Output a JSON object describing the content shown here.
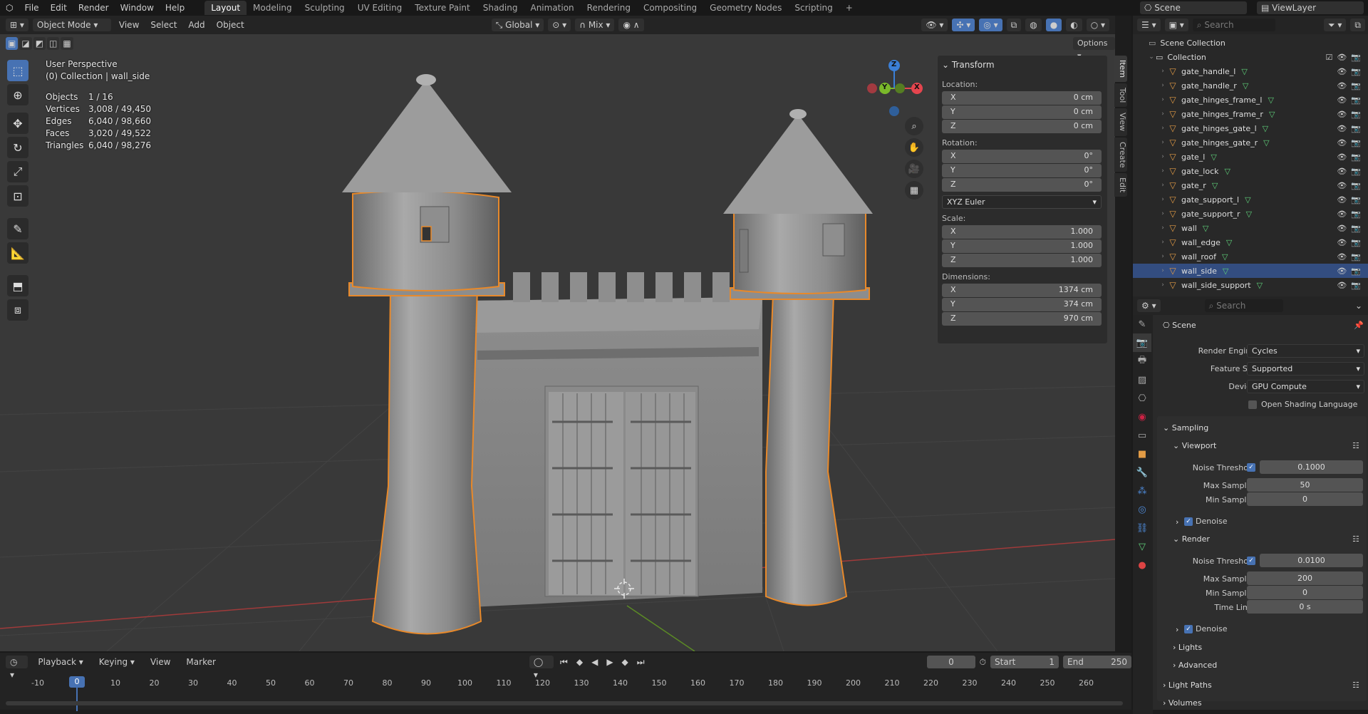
{
  "menu": {
    "items": [
      "File",
      "Edit",
      "Render",
      "Window",
      "Help"
    ]
  },
  "workspaces": [
    "Layout",
    "Modeling",
    "Sculpting",
    "UV Editing",
    "Texture Paint",
    "Shading",
    "Animation",
    "Rendering",
    "Compositing",
    "Geometry Nodes",
    "Scripting"
  ],
  "top_right": {
    "scene": "Scene",
    "view_layer": "ViewLayer"
  },
  "vp_header": {
    "mode": "Object Mode",
    "menus": [
      "View",
      "Select",
      "Add",
      "Object"
    ],
    "orientation": "Global",
    "snap": "Mix",
    "options": "Options"
  },
  "overlay": {
    "perspective": "User Perspective",
    "collection": "(0) Collection | wall_side",
    "stats": [
      {
        "k": "Objects",
        "v": "1 / 16"
      },
      {
        "k": "Vertices",
        "v": "3,008 / 49,450"
      },
      {
        "k": "Edges",
        "v": "6,040 / 98,660"
      },
      {
        "k": "Faces",
        "v": "3,020 / 49,522"
      },
      {
        "k": "Triangles",
        "v": "6,040 / 98,276"
      }
    ]
  },
  "transform": {
    "title": "Transform",
    "location_label": "Location:",
    "rotation_label": "Rotation:",
    "scale_label": "Scale:",
    "dimensions_label": "Dimensions:",
    "location": [
      {
        "a": "X",
        "v": "0 cm"
      },
      {
        "a": "Y",
        "v": "0 cm"
      },
      {
        "a": "Z",
        "v": "0 cm"
      }
    ],
    "rotation": [
      {
        "a": "X",
        "v": "0°"
      },
      {
        "a": "Y",
        "v": "0°"
      },
      {
        "a": "Z",
        "v": "0°"
      }
    ],
    "rotation_mode": "XYZ Euler",
    "scale": [
      {
        "a": "X",
        "v": "1.000"
      },
      {
        "a": "Y",
        "v": "1.000"
      },
      {
        "a": "Z",
        "v": "1.000"
      }
    ],
    "dimensions": [
      {
        "a": "X",
        "v": "1374 cm"
      },
      {
        "a": "Y",
        "v": "374 cm"
      },
      {
        "a": "Z",
        "v": "970 cm"
      }
    ]
  },
  "side_tabs": [
    "Item",
    "Tool",
    "View",
    "Create",
    "Edit"
  ],
  "gizmo": {
    "x": "X",
    "y": "Y",
    "z": "Z"
  },
  "outliner": {
    "search": "Search",
    "root": "Scene Collection",
    "collection": "Collection",
    "items": [
      "gate_handle_l",
      "gate_handle_r",
      "gate_hinges_frame_l",
      "gate_hinges_frame_r",
      "gate_hinges_gate_l",
      "gate_hinges_gate_r",
      "gate_l",
      "gate_lock",
      "gate_r",
      "gate_support_l",
      "gate_support_r",
      "wall",
      "wall_edge",
      "wall_roof",
      "wall_side",
      "wall_side_support"
    ],
    "selected": "wall_side"
  },
  "props": {
    "search": "Search",
    "scene": "Scene",
    "render_engine_label": "Render Engine",
    "render_engine": "Cycles",
    "feature_set_label": "Feature Set",
    "feature_set": "Supported",
    "device_label": "Device",
    "device": "GPU Compute",
    "osl": "Open Shading Language",
    "sampling": "Sampling",
    "viewport": "Viewport",
    "noise_threshold": "Noise Threshold",
    "vp_noise": "0.1000",
    "max_samples": "Max Samples",
    "vp_max": "50",
    "min_samples": "Min Samples",
    "vp_min": "0",
    "denoise": "Denoise",
    "render": "Render",
    "r_noise": "0.0100",
    "r_max": "200",
    "r_min": "0",
    "time_limit": "Time Limit",
    "r_time": "0 s",
    "lights": "Lights",
    "advanced": "Advanced",
    "light_paths": "Light Paths",
    "volumes": "Volumes"
  },
  "timeline": {
    "menus": [
      "Playback",
      "Keying",
      "View",
      "Marker"
    ],
    "current": "0",
    "start_label": "Start",
    "start": "1",
    "end_label": "End",
    "end": "250",
    "ticks": [
      "-10",
      "0",
      "10",
      "20",
      "30",
      "40",
      "50",
      "60",
      "70",
      "80",
      "90",
      "100",
      "110",
      "120",
      "130",
      "140",
      "150",
      "160",
      "170",
      "180",
      "190",
      "200",
      "210",
      "220",
      "230",
      "240",
      "250",
      "260"
    ]
  },
  "colors": {
    "accent": "#4772b3",
    "selection": "#e8892a",
    "x_axis": "#e5454e",
    "y_axis": "#7ab82a",
    "z_axis": "#3b7fd6"
  }
}
